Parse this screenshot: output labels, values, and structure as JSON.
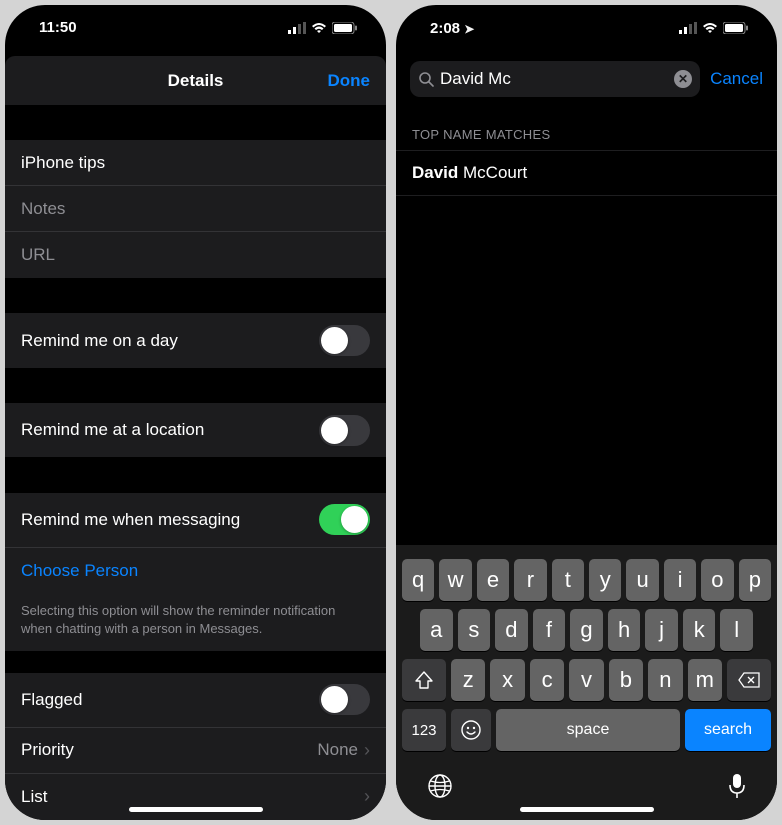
{
  "left": {
    "status": {
      "time": "11:50"
    },
    "header": {
      "title": "Details",
      "done": "Done"
    },
    "title_field": "iPhone tips",
    "notes_placeholder": "Notes",
    "url_placeholder": "URL",
    "remind_day": {
      "label": "Remind me on a day",
      "on": false
    },
    "remind_location": {
      "label": "Remind me at a location",
      "on": false
    },
    "remind_messaging": {
      "label": "Remind me when messaging",
      "on": true
    },
    "choose_person": "Choose Person",
    "messaging_note": "Selecting this option will show the reminder notification when chatting with a person in Messages.",
    "flagged": {
      "label": "Flagged",
      "on": false
    },
    "priority": {
      "label": "Priority",
      "value": "None"
    },
    "list": {
      "label": "List"
    }
  },
  "right": {
    "status": {
      "time": "2:08"
    },
    "search": {
      "value": "David Mc",
      "cancel": "Cancel"
    },
    "section_header": "TOP NAME MATCHES",
    "match": {
      "bold": "David",
      "rest": " McCourt"
    },
    "keyboard": {
      "rows": [
        [
          "q",
          "w",
          "e",
          "r",
          "t",
          "y",
          "u",
          "i",
          "o",
          "p"
        ],
        [
          "a",
          "s",
          "d",
          "f",
          "g",
          "h",
          "j",
          "k",
          "l"
        ],
        [
          "z",
          "x",
          "c",
          "v",
          "b",
          "n",
          "m"
        ]
      ],
      "num": "123",
      "space": "space",
      "search": "search"
    }
  }
}
